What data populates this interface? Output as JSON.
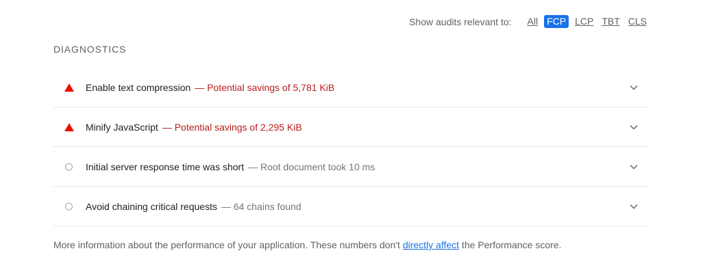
{
  "filter": {
    "label": "Show audits relevant to:",
    "options": [
      "All",
      "FCP",
      "LCP",
      "TBT",
      "CLS"
    ],
    "active": "FCP",
    "active_color": "#1a73e8"
  },
  "section": {
    "title": "DIAGNOSTICS"
  },
  "audits": [
    {
      "status": "fail",
      "icon": "red-triangle-icon",
      "title": "Enable text compression",
      "detail": "— Potential savings of 5,781 KiB"
    },
    {
      "status": "fail",
      "icon": "red-triangle-icon",
      "title": "Minify JavaScript",
      "detail": "— Potential savings of 2,295 KiB"
    },
    {
      "status": "info",
      "icon": "gray-circle-icon",
      "title": "Initial server response time was short",
      "detail": "— Root document took 10 ms"
    },
    {
      "status": "info",
      "icon": "gray-circle-icon",
      "title": "Avoid chaining critical requests",
      "detail": "— 64 chains found"
    }
  ],
  "footer": {
    "text_before": "More information about the performance of your application. These numbers don't ",
    "link_text": "directly affect",
    "text_after": " the Performance score."
  },
  "colors": {
    "fail": "#eb0f00",
    "fail_text": "#b71c1c",
    "info_icon": "#9e9e9e",
    "link": "#1a73e8"
  }
}
